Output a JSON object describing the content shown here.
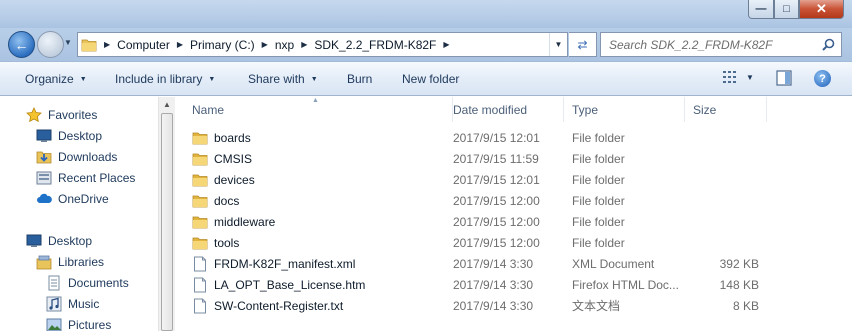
{
  "window": {
    "minimize_icon": "minimize-icon",
    "maximize_icon": "maximize-icon",
    "close_icon": "close-icon"
  },
  "address_bar": {
    "breadcrumbs": [
      "Computer",
      "Primary (C:)",
      "nxp",
      "SDK_2.2_FRDM-K82F"
    ]
  },
  "search": {
    "placeholder": "Search SDK_2.2_FRDM-K82F"
  },
  "toolbar": {
    "organize": "Organize",
    "include_in_library": "Include in library",
    "share_with": "Share with",
    "burn": "Burn",
    "new_folder": "New folder"
  },
  "nav_pane": {
    "favorites": "Favorites",
    "favorites_items": [
      "Desktop",
      "Downloads",
      "Recent Places",
      "OneDrive"
    ],
    "desktop": "Desktop",
    "libraries": "Libraries",
    "library_items": [
      "Documents",
      "Music",
      "Pictures"
    ]
  },
  "columns": {
    "name": "Name",
    "date_modified": "Date modified",
    "type": "Type",
    "size": "Size"
  },
  "files": [
    {
      "name": "boards",
      "date": "2017/9/15 12:01",
      "type": "File folder",
      "size": "",
      "icon": "folder-icon"
    },
    {
      "name": "CMSIS",
      "date": "2017/9/15 11:59",
      "type": "File folder",
      "size": "",
      "icon": "folder-icon"
    },
    {
      "name": "devices",
      "date": "2017/9/15 12:01",
      "type": "File folder",
      "size": "",
      "icon": "folder-icon"
    },
    {
      "name": "docs",
      "date": "2017/9/15 12:00",
      "type": "File folder",
      "size": "",
      "icon": "folder-icon"
    },
    {
      "name": "middleware",
      "date": "2017/9/15 12:00",
      "type": "File folder",
      "size": "",
      "icon": "folder-icon"
    },
    {
      "name": "tools",
      "date": "2017/9/15 12:00",
      "type": "File folder",
      "size": "",
      "icon": "folder-icon"
    },
    {
      "name": "FRDM-K82F_manifest.xml",
      "date": "2017/9/14 3:30",
      "type": "XML Document",
      "size": "392 KB",
      "icon": "document-icon"
    },
    {
      "name": "LA_OPT_Base_License.htm",
      "date": "2017/9/14 3:30",
      "type": "Firefox HTML Doc...",
      "size": "148 KB",
      "icon": "document-icon"
    },
    {
      "name": "SW-Content-Register.txt",
      "date": "2017/9/14 3:30",
      "type": "文本文档",
      "size": "8 KB",
      "icon": "document-icon"
    }
  ]
}
